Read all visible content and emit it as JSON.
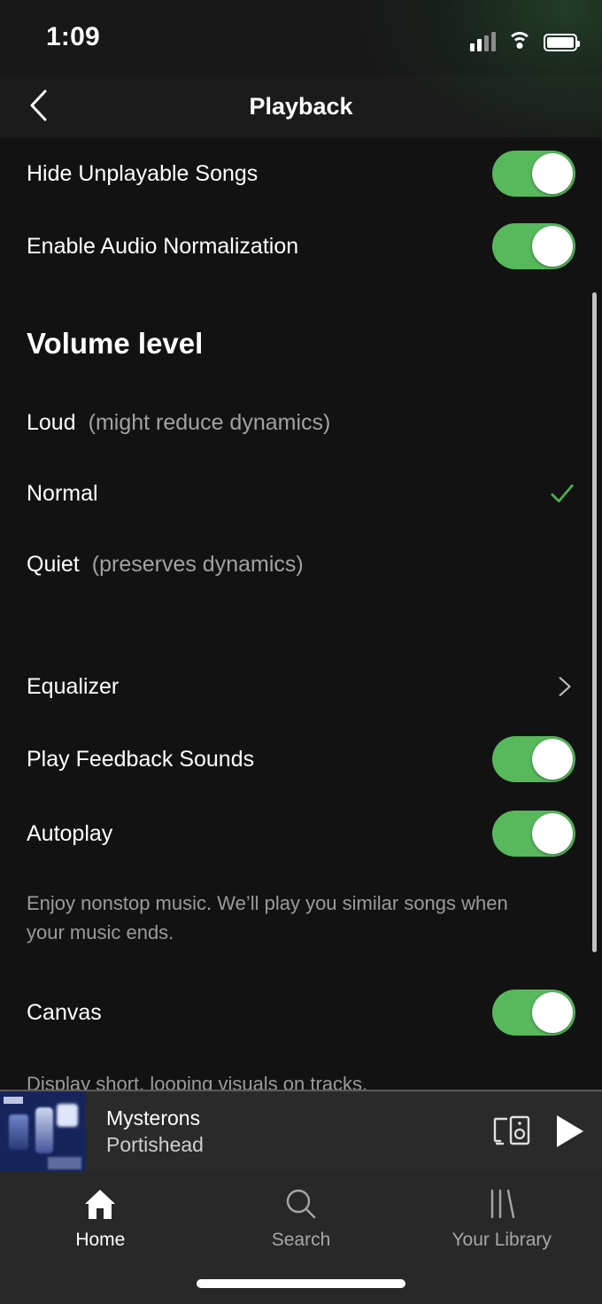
{
  "status_bar": {
    "time": "1:09",
    "cellular_icon": "cellular-signal-icon",
    "wifi_icon": "wifi-icon",
    "battery_icon": "battery-full-icon"
  },
  "header": {
    "back_icon": "chevron-left-icon",
    "title": "Playback"
  },
  "settings": {
    "top_toggles": [
      {
        "label": "Hide Unplayable Songs",
        "state": "on"
      },
      {
        "label": "Enable Audio Normalization",
        "state": "on"
      }
    ],
    "volume_section": {
      "title": "Volume level",
      "options": [
        {
          "name": "Loud",
          "hint": "(might reduce dynamics)",
          "selected": false
        },
        {
          "name": "Normal",
          "hint": "",
          "selected": true
        },
        {
          "name": "Quiet",
          "hint": "(preserves dynamics)",
          "selected": false
        }
      ],
      "check_icon": "checkmark-icon",
      "check_color": "#4caf50"
    },
    "equalizer": {
      "label": "Equalizer",
      "chevron_icon": "chevron-right-icon"
    },
    "feedback_toggle": {
      "label": "Play Feedback Sounds",
      "state": "on"
    },
    "autoplay_toggle": {
      "label": "Autoplay",
      "state": "on"
    },
    "autoplay_description": "Enjoy nonstop music. We’ll play you similar songs when your music ends.",
    "canvas_toggle": {
      "label": "Canvas",
      "state": "on"
    },
    "canvas_description": "Display short, looping visuals on tracks."
  },
  "now_playing": {
    "album_art": "album-artwork",
    "track": "Mysterons",
    "artist": "Portishead",
    "device_icon": "connect-to-device-icon",
    "play_icon": "play-icon"
  },
  "tab_bar": {
    "tabs": [
      {
        "label": "Home",
        "icon": "home-icon",
        "active": true
      },
      {
        "label": "Search",
        "icon": "search-icon",
        "active": false
      },
      {
        "label": "Your Library",
        "icon": "library-icon",
        "active": false
      }
    ]
  },
  "colors": {
    "background": "#121212",
    "toggle_on": "#57b85c",
    "now_playing_bg": "#2a2a2a",
    "tab_bar_bg": "#282828",
    "accent_green": "#4caf50",
    "muted_text": "#9b9b9b"
  }
}
